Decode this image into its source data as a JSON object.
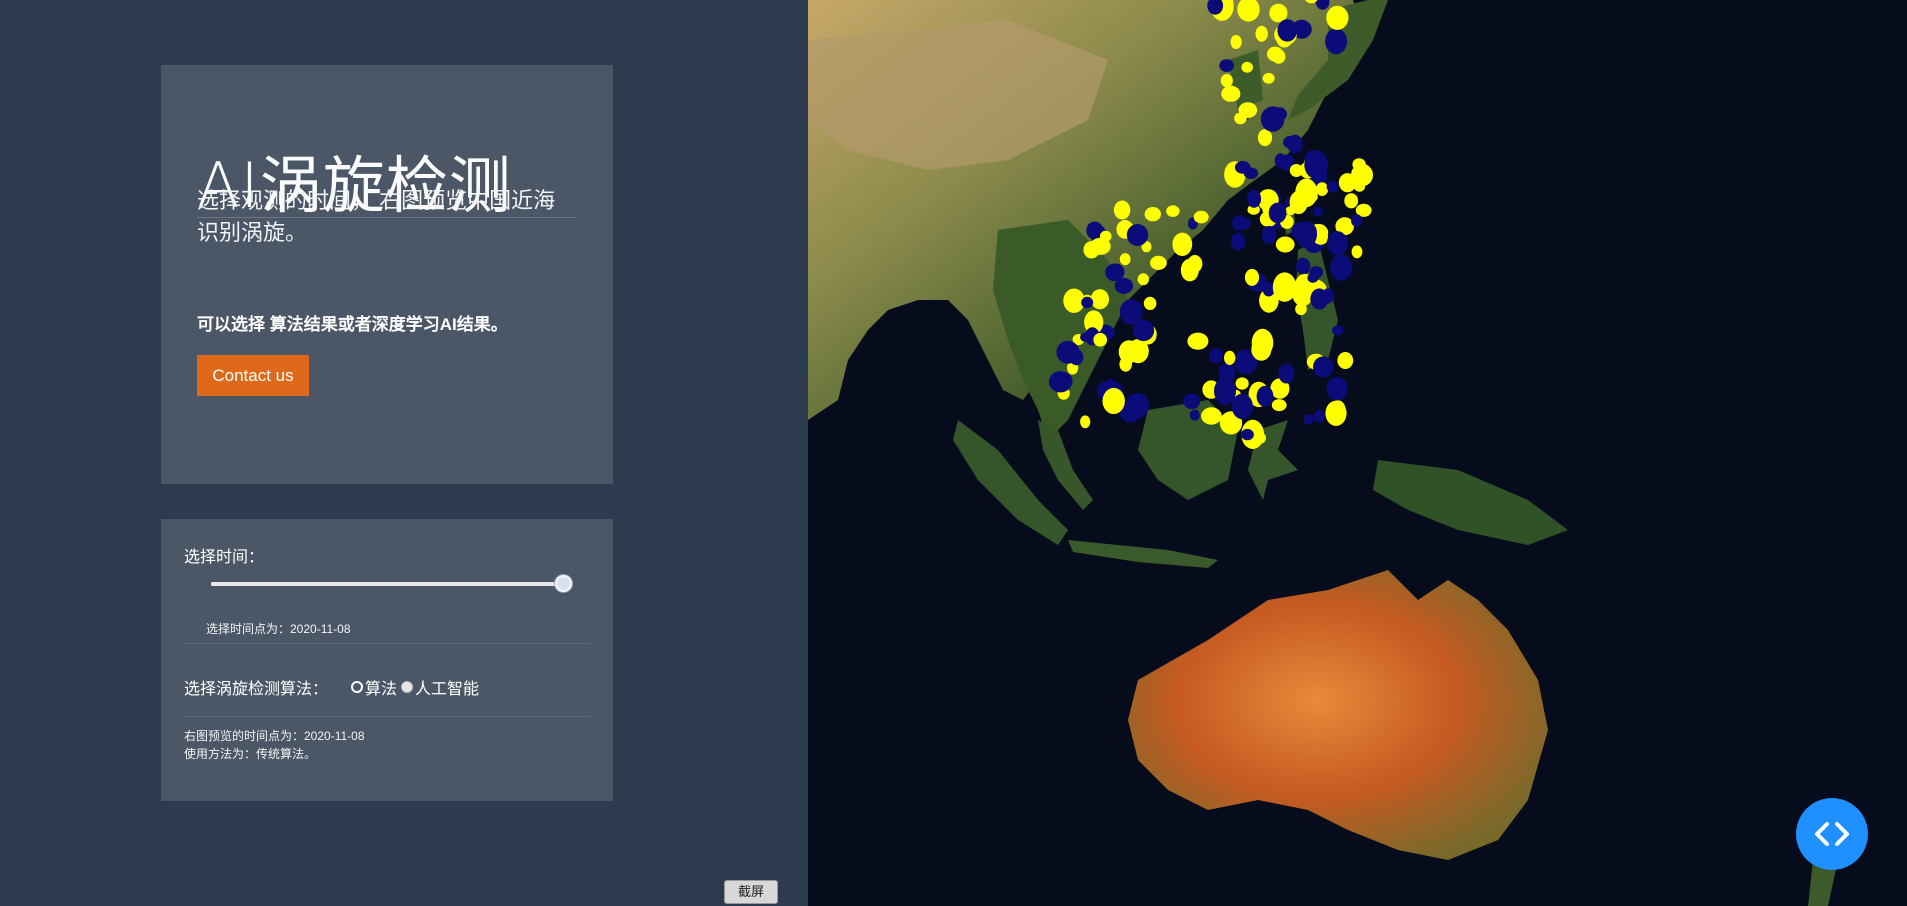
{
  "hero": {
    "title": "AI涡旋检测",
    "lead": "选择观测的时间，  右图预览中国近海识别涡旋。",
    "sub": "可以选择 算法结果或者深度学习AI结果。",
    "contact_label": "Contact us"
  },
  "controls": {
    "time_label": "选择时间：",
    "slider_value_fraction": 1.0,
    "time_note": "选择时间点为：2020-11-08",
    "algo_label": "选择涡旋检测算法：",
    "options": [
      "算法",
      "人工智能"
    ],
    "selected_option": "人工智能",
    "preview_line1": "右图预览的时间点为：2020-11-08",
    "preview_line2": "使用方法为：传统算法。"
  },
  "toolbar": {
    "screenshot_label": "截屏"
  },
  "map": {
    "eddy_colors": {
      "anticyclonic": "#ffff00",
      "cyclonic": "#0b0b7a"
    }
  },
  "icons": {
    "code_button": "code-icon"
  }
}
